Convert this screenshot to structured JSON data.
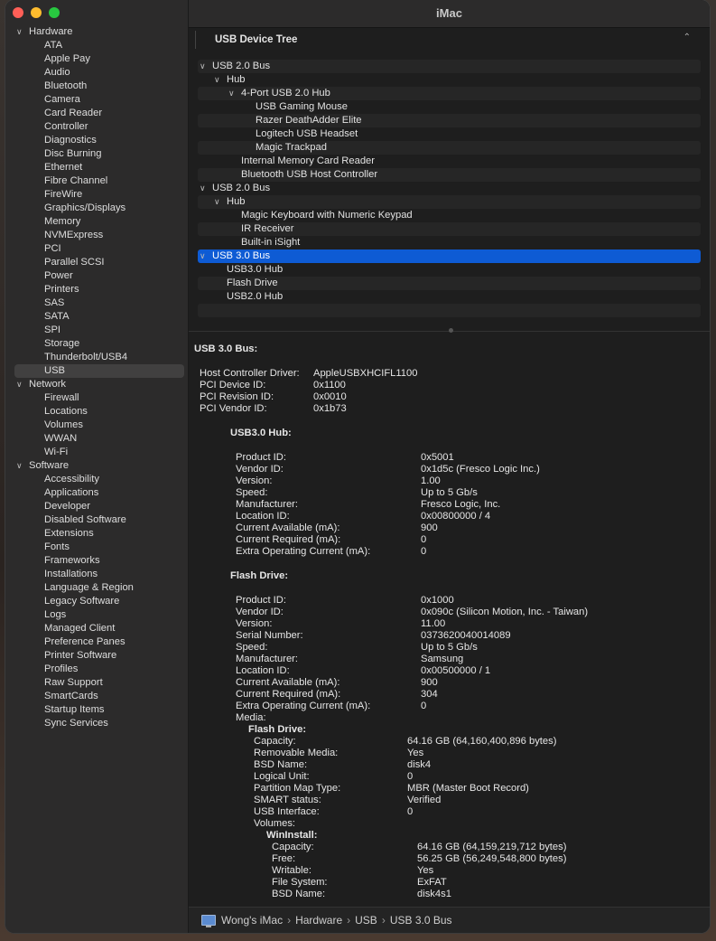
{
  "window": {
    "title": "iMac"
  },
  "sidebar": {
    "groups": [
      {
        "label": "Hardware",
        "items": [
          "ATA",
          "Apple Pay",
          "Audio",
          "Bluetooth",
          "Camera",
          "Card Reader",
          "Controller",
          "Diagnostics",
          "Disc Burning",
          "Ethernet",
          "Fibre Channel",
          "FireWire",
          "Graphics/Displays",
          "Memory",
          "NVMExpress",
          "PCI",
          "Parallel SCSI",
          "Power",
          "Printers",
          "SAS",
          "SATA",
          "SPI",
          "Storage",
          "Thunderbolt/USB4",
          "USB"
        ]
      },
      {
        "label": "Network",
        "items": [
          "Firewall",
          "Locations",
          "Volumes",
          "WWAN",
          "Wi-Fi"
        ]
      },
      {
        "label": "Software",
        "items": [
          "Accessibility",
          "Applications",
          "Developer",
          "Disabled Software",
          "Extensions",
          "Fonts",
          "Frameworks",
          "Installations",
          "Language & Region",
          "Legacy Software",
          "Logs",
          "Managed Client",
          "Preference Panes",
          "Printer Software",
          "Profiles",
          "Raw Support",
          "SmartCards",
          "Startup Items",
          "Sync Services"
        ]
      }
    ],
    "selected": "USB"
  },
  "section": {
    "title": "USB Device Tree"
  },
  "tree": [
    {
      "label": "USB 2.0 Bus",
      "level": 0,
      "chevron": true
    },
    {
      "label": "Hub",
      "level": 1,
      "chevron": true
    },
    {
      "label": "4-Port USB 2.0 Hub",
      "level": 2,
      "chevron": true
    },
    {
      "label": "USB Gaming Mouse",
      "level": 3
    },
    {
      "label": "Razer DeathAdder Elite",
      "level": 3
    },
    {
      "label": "Logitech USB Headset",
      "level": 3
    },
    {
      "label": "Magic Trackpad",
      "level": 3
    },
    {
      "label": "Internal Memory Card Reader",
      "level": 2
    },
    {
      "label": "Bluetooth USB Host Controller",
      "level": 2
    },
    {
      "label": "USB 2.0 Bus",
      "level": 0,
      "chevron": true
    },
    {
      "label": "Hub",
      "level": 1,
      "chevron": true
    },
    {
      "label": "Magic Keyboard with Numeric Keypad",
      "level": 2
    },
    {
      "label": "IR Receiver",
      "level": 2
    },
    {
      "label": "Built-in iSight",
      "level": 2
    },
    {
      "label": "USB 3.0 Bus",
      "level": 0,
      "chevron": true,
      "selected": true
    },
    {
      "label": "USB3.0 Hub",
      "level": 1
    },
    {
      "label": "Flash Drive",
      "level": 1
    },
    {
      "label": "USB2.0 Hub",
      "level": 1
    },
    {
      "label": "",
      "level": 0
    },
    {
      "label": "",
      "level": 0
    }
  ],
  "detail": {
    "heading": "USB 3.0 Bus:",
    "bus_props": [
      {
        "k": "Host Controller Driver:",
        "v": "AppleUSBXHCIFL1100"
      },
      {
        "k": "PCI Device ID:",
        "v": "0x1100"
      },
      {
        "k": "PCI Revision ID:",
        "v": "0x0010"
      },
      {
        "k": "PCI Vendor ID:",
        "v": "0x1b73"
      }
    ],
    "hub_heading": "USB3.0 Hub:",
    "hub_props": [
      {
        "k": "Product ID:",
        "v": "0x5001"
      },
      {
        "k": "Vendor ID:",
        "v": "0x1d5c  (Fresco Logic Inc.)"
      },
      {
        "k": "Version:",
        "v": "1.00"
      },
      {
        "k": "Speed:",
        "v": "Up to 5 Gb/s"
      },
      {
        "k": "Manufacturer:",
        "v": "Fresco Logic, Inc."
      },
      {
        "k": "Location ID:",
        "v": "0x00800000 / 4"
      },
      {
        "k": "Current Available (mA):",
        "v": "900"
      },
      {
        "k": "Current Required (mA):",
        "v": "0"
      },
      {
        "k": "Extra Operating Current (mA):",
        "v": "0"
      }
    ],
    "flash_heading": "Flash Drive:",
    "flash_props": [
      {
        "k": "Product ID:",
        "v": "0x1000"
      },
      {
        "k": "Vendor ID:",
        "v": "0x090c  (Silicon Motion, Inc. - Taiwan)"
      },
      {
        "k": "Version:",
        "v": "11.00"
      },
      {
        "k": "Serial Number:",
        "v": "0373620040014089"
      },
      {
        "k": "Speed:",
        "v": "Up to 5 Gb/s"
      },
      {
        "k": "Manufacturer:",
        "v": "Samsung"
      },
      {
        "k": "Location ID:",
        "v": "0x00500000 / 1"
      },
      {
        "k": "Current Available (mA):",
        "v": "900"
      },
      {
        "k": "Current Required (mA):",
        "v": "304"
      },
      {
        "k": "Extra Operating Current (mA):",
        "v": "0"
      },
      {
        "k": "Media:",
        "v": ""
      }
    ],
    "media_heading": "Flash Drive:",
    "media_props": [
      {
        "k": "Capacity:",
        "v": "64.16 GB (64,160,400,896 bytes)"
      },
      {
        "k": "Removable Media:",
        "v": "Yes"
      },
      {
        "k": "BSD Name:",
        "v": "disk4"
      },
      {
        "k": "Logical Unit:",
        "v": "0"
      },
      {
        "k": "Partition Map Type:",
        "v": "MBR (Master Boot Record)"
      },
      {
        "k": "SMART status:",
        "v": "Verified"
      },
      {
        "k": "USB Interface:",
        "v": "0"
      },
      {
        "k": "Volumes:",
        "v": ""
      }
    ],
    "volume_heading": "WinInstall:",
    "volume_props": [
      {
        "k": "Capacity:",
        "v": "64.16 GB (64,159,219,712 bytes)"
      },
      {
        "k": "Free:",
        "v": "56.25 GB (56,249,548,800 bytes)"
      },
      {
        "k": "Writable:",
        "v": "Yes"
      },
      {
        "k": "File System:",
        "v": "ExFAT"
      },
      {
        "k": "BSD Name:",
        "v": "disk4s1"
      }
    ]
  },
  "breadcrumb": [
    "Wong's iMac",
    "Hardware",
    "USB",
    "USB 3.0 Bus"
  ],
  "icons": {
    "computer": "imac-icon",
    "separator": "chevron-right-icon"
  }
}
